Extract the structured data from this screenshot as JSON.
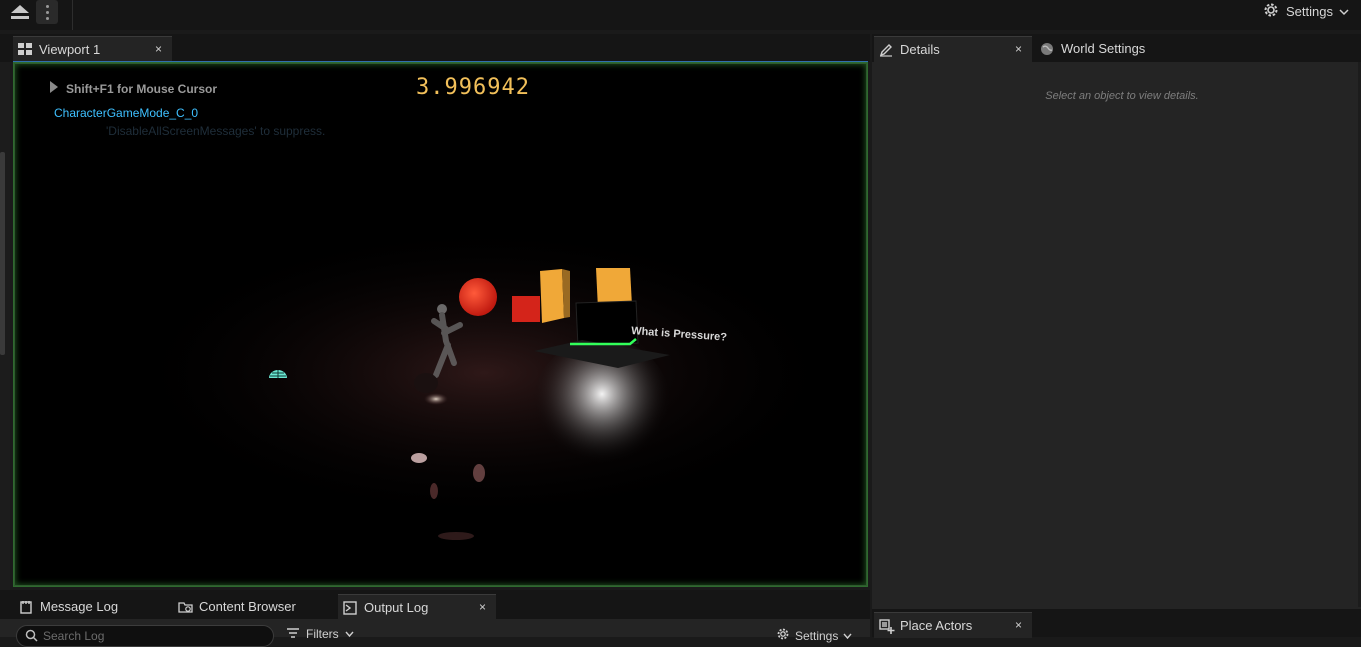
{
  "toolbar": {
    "settings_label": "Settings"
  },
  "viewport_tab": {
    "label": "Viewport 1",
    "close": "×"
  },
  "viewport": {
    "mouse_hint": "Shift+F1 for Mouse Cursor",
    "game_mode": "CharacterGameMode_C_0",
    "suppress_msg": "'DisableAllScreenMessages' to suppress.",
    "timer_value": "3.996942",
    "sign_text": "What is Pressure?"
  },
  "right_panel": {
    "details_tab": "Details",
    "details_close": "×",
    "world_settings_tab": "World Settings",
    "empty_message": "Select an object to view details.",
    "place_actors_tab": "Place Actors",
    "place_actors_close": "×"
  },
  "bottom": {
    "message_log_tab": "Message Log",
    "content_browser_tab": "Content Browser",
    "output_log_tab": "Output Log",
    "output_log_close": "×",
    "search_placeholder": "Search Log",
    "filters_label": "Filters",
    "settings_label": "Settings"
  },
  "colors": {
    "timer": "#f2c05a",
    "game_mode_text": "#3ec0ff",
    "viewport_border": "#2e6a2e"
  },
  "icons": [
    "eject-icon",
    "kebab-icon",
    "gear-icon",
    "viewport-icon",
    "details-icon",
    "globe-icon",
    "place-actors-icon",
    "message-log-icon",
    "content-browser-icon",
    "output-log-icon",
    "search-icon",
    "filter-icon",
    "chevron-down-icon"
  ]
}
